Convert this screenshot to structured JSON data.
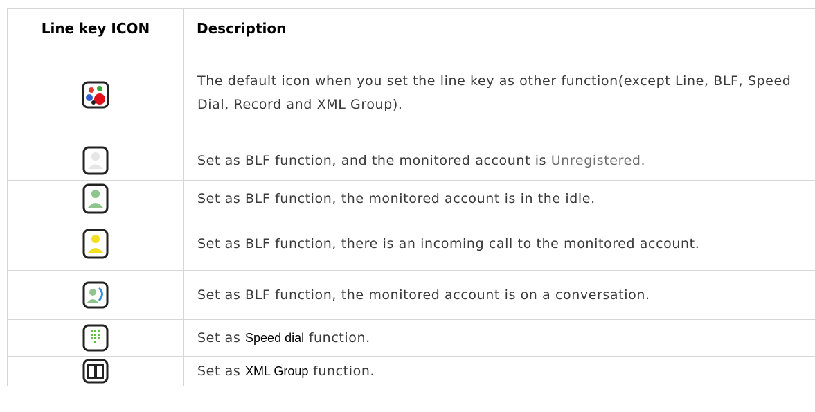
{
  "table": {
    "header": {
      "icon_col": "Line key ICON",
      "desc_col": "Description"
    },
    "rows": [
      {
        "icon": "default-function-icon",
        "desc": "The default icon when you set the line key as other function(except Line, BLF, Speed Dial, Record and XML Group)."
      },
      {
        "icon": "blf-unregistered-icon",
        "desc_pre": "Set as BLF function, and the monitored account is ",
        "desc_term": "Unregistered.",
        "desc_post": ""
      },
      {
        "icon": "blf-idle-icon",
        "desc": "Set as BLF function, the monitored account is in the idle."
      },
      {
        "icon": "blf-incoming-call-icon",
        "desc": "Set as BLF function, there is an incoming call to the monitored account."
      },
      {
        "icon": "blf-conversation-icon",
        "desc": "Set as BLF function, the monitored account is on a conversation."
      },
      {
        "icon": "speed-dial-icon",
        "desc_pre": "Set as ",
        "desc_term": "Speed dial",
        "desc_post": " function."
      },
      {
        "icon": "xml-group-icon",
        "desc_pre": "Set as ",
        "desc_term": "XML Group",
        "desc_post": " function."
      }
    ]
  }
}
